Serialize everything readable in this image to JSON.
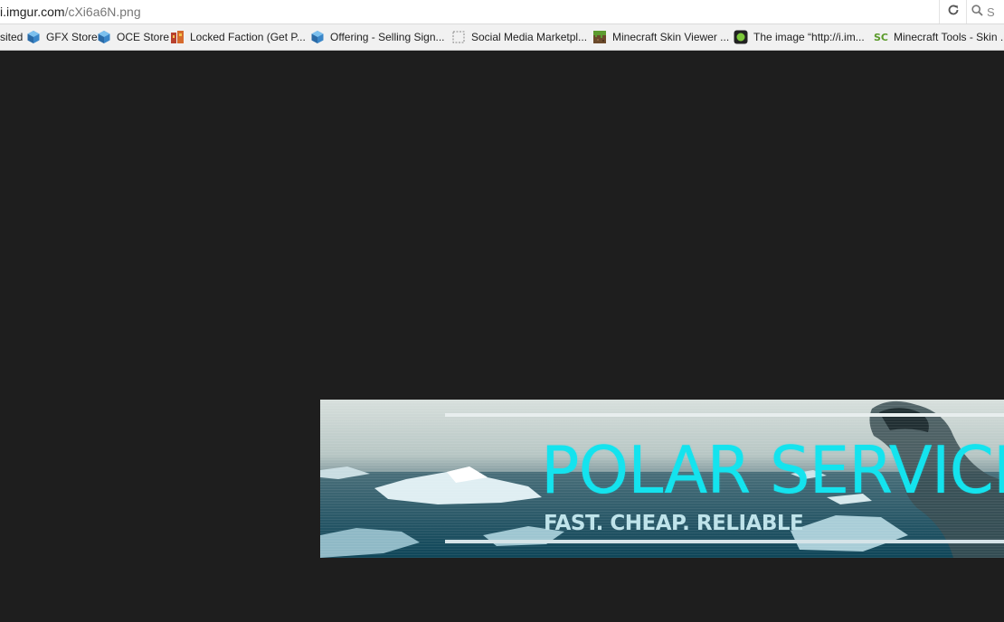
{
  "browser": {
    "url_host": "i.imgur.com",
    "url_path": "/cXi6a6N.png",
    "search_placeholder": "S"
  },
  "bookmarks": [
    {
      "label": "sited",
      "icon": "none"
    },
    {
      "label": "GFX Store",
      "icon": "cube-icon"
    },
    {
      "label": "OCE Store",
      "icon": "cube-icon"
    },
    {
      "label": "Locked Faction (Get P...",
      "icon": "faction-icon"
    },
    {
      "label": "Offering - Selling Sign...",
      "icon": "cube-icon"
    },
    {
      "label": "Social Media Marketpl...",
      "icon": "dashed-page-icon"
    },
    {
      "label": "Minecraft Skin Viewer ...",
      "icon": "grass-block-icon"
    },
    {
      "label": "The image “http://i.im...",
      "icon": "green-dot-icon"
    },
    {
      "label": "Minecraft Tools - Skin ...",
      "icon": "sc-logo-icon"
    }
  ],
  "banner": {
    "title": "POLAR SERVICES",
    "tagline": "FAST. CHEAP. RELIABLE",
    "title_color": "#14e3ee"
  },
  "colors": {
    "page_background": "#1e1e1e",
    "bookmark_bar": "#f1f1f1",
    "cube_blue": "#3a86c8"
  }
}
